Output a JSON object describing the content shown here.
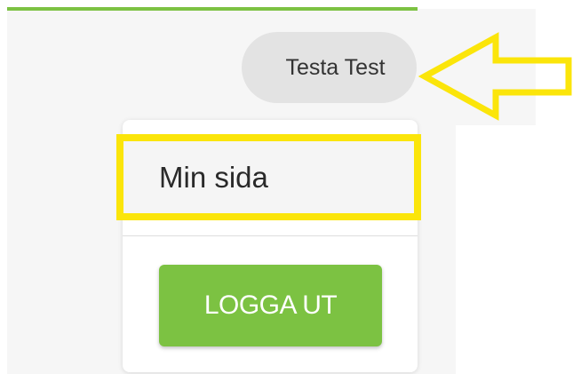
{
  "header": {
    "accent_color": "#7cc242"
  },
  "user_menu": {
    "name": "Testa Test"
  },
  "dropdown": {
    "items": [
      {
        "label": "Min sida"
      }
    ],
    "logout_label": "LOGGA UT"
  },
  "annotations": {
    "highlight_color": "#fbe50a",
    "arrow_icon": "arrow-left-outline-icon"
  }
}
